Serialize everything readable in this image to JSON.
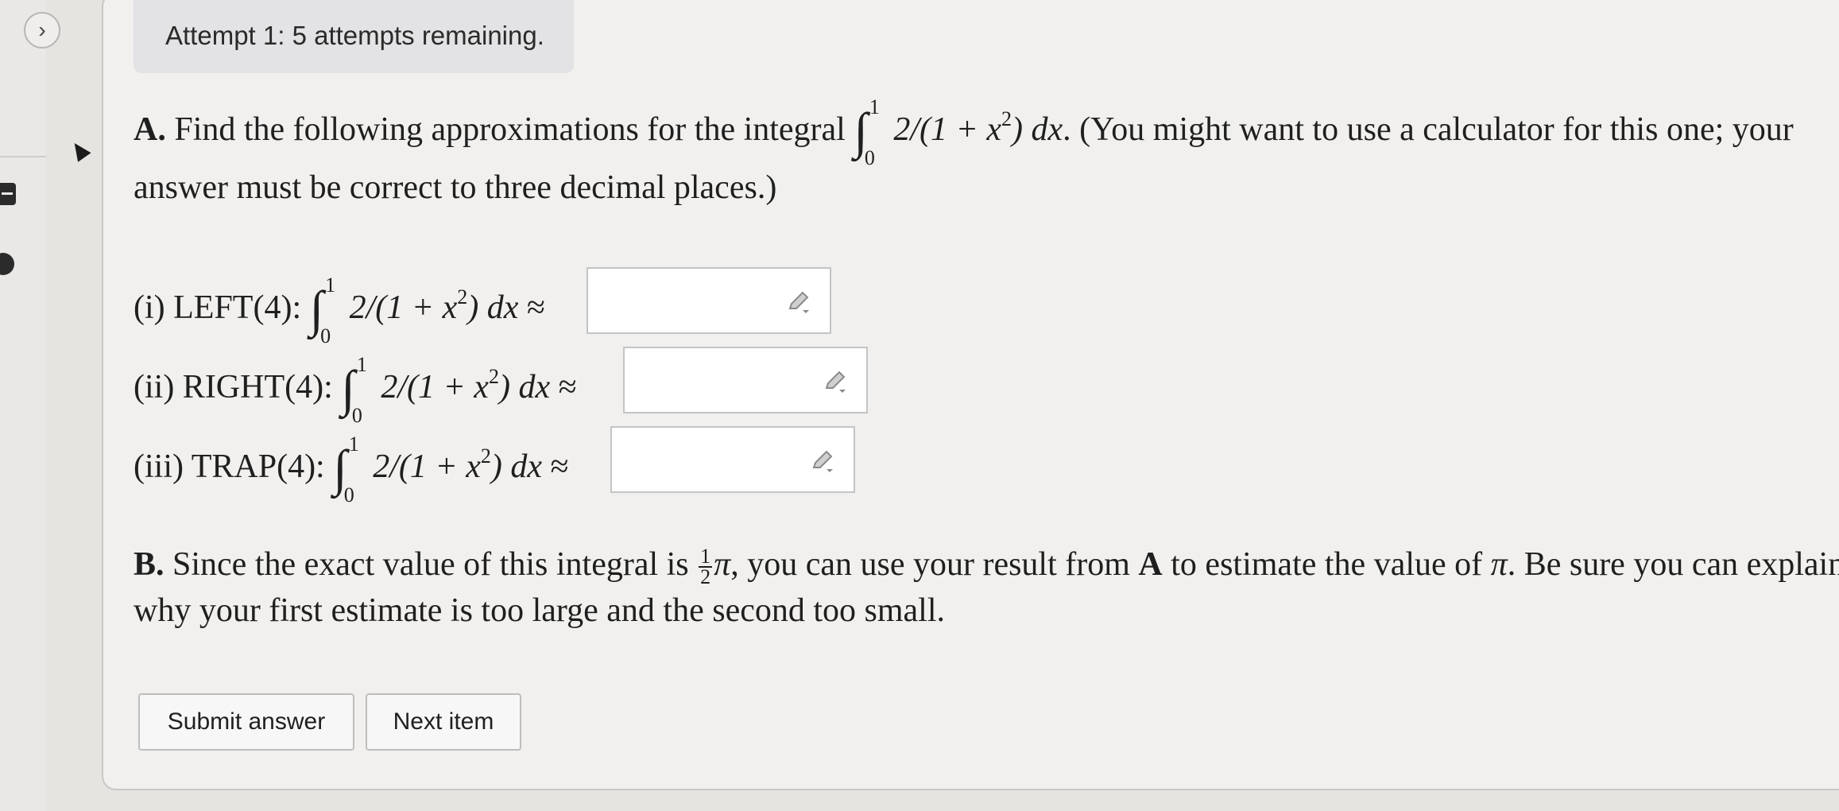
{
  "attempt_banner": "Attempt 1: 5 attempts remaining.",
  "part_a": {
    "label": "A.",
    "text_before": "Find the following approximations for the integral",
    "integrand": "2/(1 + x",
    "integrand_exp": "2",
    "integrand_close": ") dx",
    "lower": "0",
    "upper": "1",
    "text_after": ". (You might want to use a calculator for this one; your",
    "line2": "answer must be correct to three decimal places.)"
  },
  "rows": [
    {
      "label": "(i) LEFT(4):",
      "approx": "≈",
      "value": ""
    },
    {
      "label": "(ii) RIGHT(4):",
      "approx": "≈",
      "value": ""
    },
    {
      "label": "(iii) TRAP(4):",
      "approx": "≈",
      "value": ""
    }
  ],
  "part_b": {
    "label": "B.",
    "text1": "Since the exact value of this integral is",
    "frac_num": "1",
    "frac_den": "2",
    "pi": "π",
    "text2": ", you can use your result from",
    "bold_a": "A",
    "text3": "to estimate the value of",
    "text4": ". Be sure you can explain",
    "line2": "why your first estimate is too large and the second too small."
  },
  "buttons": {
    "submit": "Submit answer",
    "next": "Next item"
  },
  "colors": {
    "background": "#e6e4e1",
    "panel": "#f1f0ee",
    "banner": "#e3e3e5"
  }
}
